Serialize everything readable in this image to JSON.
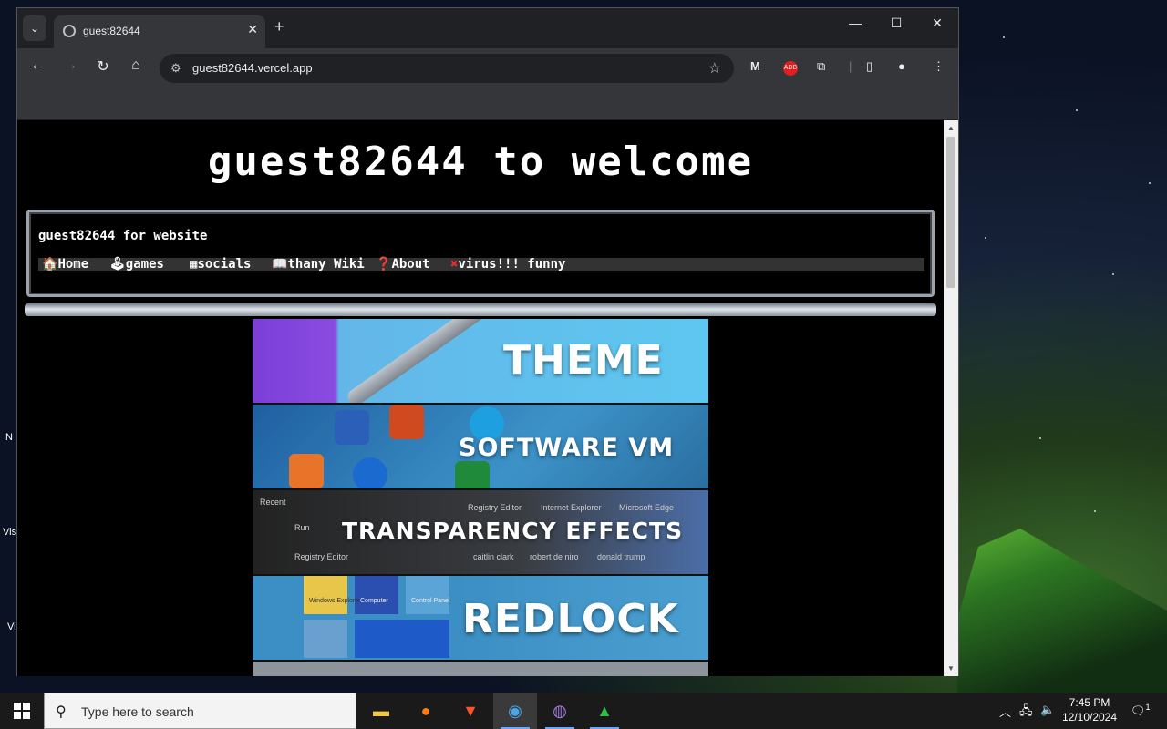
{
  "desktop": {
    "icon_labels": [
      "Vis",
      "Vi",
      "N"
    ]
  },
  "browser": {
    "tab_title": "guest82644",
    "url": "guest82644.vercel.app",
    "window_controls": {
      "minimize": "—",
      "maximize": "☐",
      "close": "✕"
    },
    "icons": {
      "tab_search": "chevron-down-icon",
      "new_tab": "plus-icon",
      "back": "back-arrow-icon",
      "forward": "forward-arrow-icon",
      "reload": "reload-icon",
      "home": "home-icon",
      "site_info": "tune-icon",
      "bookmark": "star-icon",
      "extensions": [
        "malwarebytes-icon",
        "adblock-icon",
        "puzzle-icon"
      ],
      "side_panel": "side-panel-icon",
      "profile": "profile-icon",
      "menu": "kebab-menu-icon"
    }
  },
  "page": {
    "headline": "guest82644 to welcome",
    "site_name": "guest82644 for website",
    "nav_links": [
      {
        "icon": "🏠",
        "label": "Home"
      },
      {
        "icon": "🕹",
        "label": "games"
      },
      {
        "icon": "▦",
        "label": "socials"
      },
      {
        "icon": "📖",
        "label": "thany Wiki"
      },
      {
        "icon": "❓",
        "label": "About"
      },
      {
        "icon": "✖",
        "label": "virus!!! funny"
      }
    ],
    "banners": [
      {
        "label": "THEME"
      },
      {
        "label": "SOFTWARE VM"
      },
      {
        "label": "TRANSPARENCY EFFECTS",
        "details": [
          "Recent",
          "Run",
          "Registry Editor",
          "Registry Editor",
          "Internet Explorer",
          "Microsoft Edge",
          "caitlin clark",
          "robert de niro",
          "donald trump"
        ]
      },
      {
        "label": "REDLOCK",
        "details": [
          "Windows Explorer",
          "Computer",
          "Control Panel"
        ]
      }
    ]
  },
  "taskbar": {
    "search_placeholder": "Type here to search",
    "time": "7:45 PM",
    "date": "12/10/2024",
    "notification_count": "1",
    "apps": [
      "file-explorer-icon",
      "firefox-icon",
      "brave-icon",
      "chrome-icon",
      "tor-browser-icon",
      "green-triangle-app-icon"
    ]
  }
}
